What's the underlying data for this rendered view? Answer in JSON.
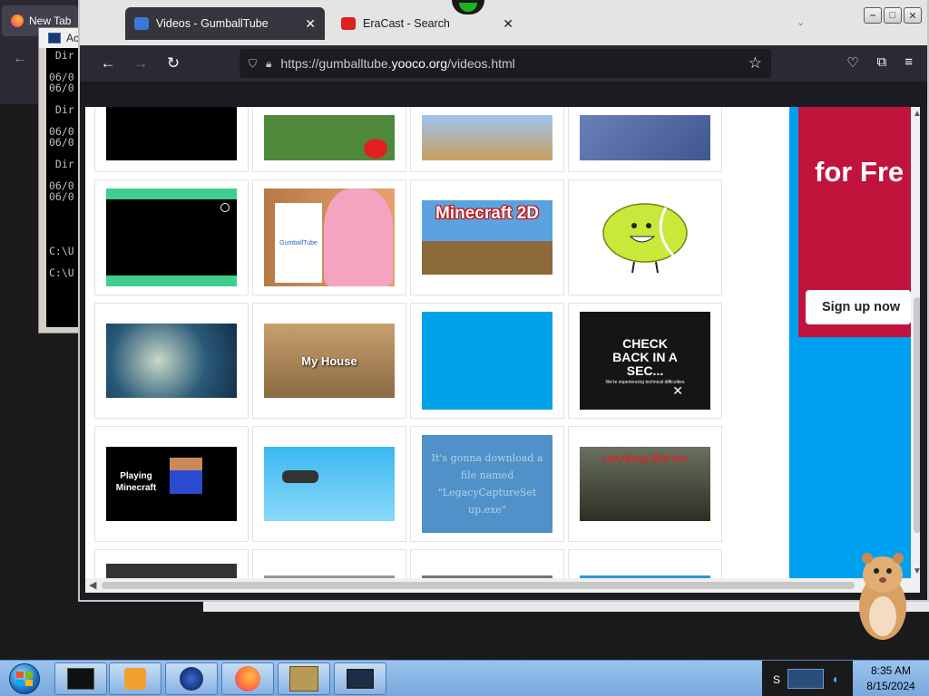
{
  "background": {
    "browser_tab_label": "New Tab",
    "cmd_title": "Ac",
    "cmd_lines": [
      " Dir",
      "",
      "06/0",
      "06/0",
      "",
      " Dir",
      "",
      "06/0",
      "06/0",
      "",
      " Dir",
      "",
      "06/0",
      "06/0",
      "",
      "",
      "",
      "",
      "C:\\U",
      "",
      "C:\\U"
    ]
  },
  "browser": {
    "tabs": [
      {
        "label": "Videos - GumballTube",
        "active": true,
        "favicon_color": "#3a78d8"
      },
      {
        "label": "EraCast - Search",
        "active": false,
        "favicon_color": "#e02020"
      }
    ],
    "url_prefix": "https://gumballtube.",
    "url_domain": "yooco.org",
    "url_suffix": "/videos.html"
  },
  "page": {
    "rows": [
      [
        {
          "name": "video-thumb-black",
          "bg": "#000",
          "text": ""
        },
        {
          "name": "video-thumb-minecraft-field",
          "bg": "#4f8a3c",
          "text": ""
        },
        {
          "name": "video-thumb-minecraft-village",
          "bg": "#7aa0d0",
          "text": ""
        },
        {
          "name": "video-thumb-minecraft-sky",
          "bg": "#5570a8",
          "text": ""
        }
      ],
      [
        {
          "name": "video-thumb-green-bars",
          "bg": "#000",
          "text": ""
        },
        {
          "name": "video-thumb-anais",
          "bg": "#d98a50",
          "text": "GumballTube"
        },
        {
          "name": "video-thumb-minecraft-2d",
          "bg": "#5aa3e0",
          "text": "Minecraft 2D"
        },
        {
          "name": "video-thumb-tennis-ball",
          "bg": "#ffffff",
          "text": ""
        }
      ],
      [
        {
          "name": "video-thumb-fish-face",
          "bg": "#2a5a78",
          "text": ""
        },
        {
          "name": "video-thumb-my-house",
          "bg": "#8a6a40",
          "text": "My House"
        },
        {
          "name": "video-thumb-blue",
          "bg": "#00a2e8",
          "text": ""
        },
        {
          "name": "video-thumb-check-back",
          "bg": "#111",
          "text": "CHECK BACK IN A SEC..."
        }
      ],
      [
        {
          "name": "video-thumb-playing-minecraft",
          "bg": "#000",
          "text": "Playing Minecraft"
        },
        {
          "name": "video-thumb-game-helicopter",
          "bg": "#3ab8f0",
          "text": ""
        },
        {
          "name": "video-thumb-download-note",
          "bg": "#4f91c8",
          "text": "It's gonna download a file named \"LegacyCaptureSet up.exe\""
        },
        {
          "name": "video-thumb-zabash",
          "bg": "#3c4030",
          "text": "«ЗА*БАШ ЙОГО!»"
        }
      ]
    ],
    "check_back_sub": "We're experiencing technical difficulties",
    "ad_text": "for Fre",
    "ad_button": "Sign up now"
  },
  "taskbar": {
    "time": "8:35 AM",
    "date": "8/15/2024",
    "tray_letter": "S"
  }
}
